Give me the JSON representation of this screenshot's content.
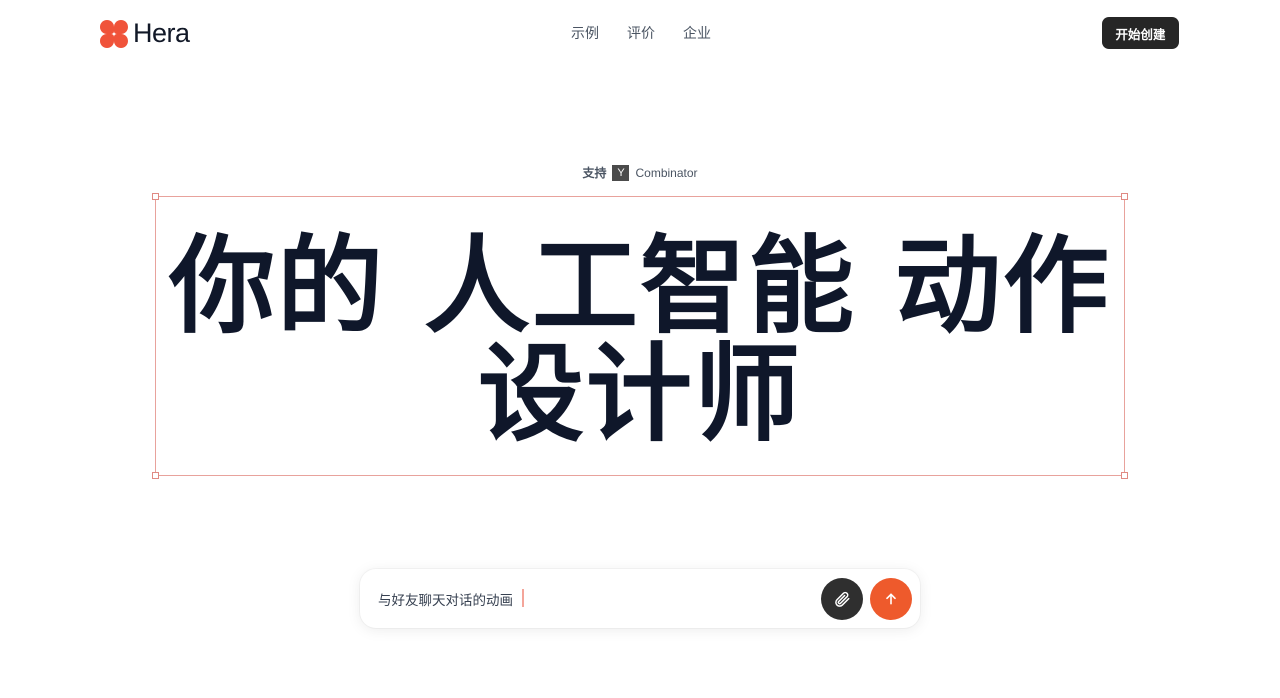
{
  "header": {
    "brand": "Hera",
    "nav": [
      "示例",
      "评价",
      "企业"
    ],
    "cta_label": "开始创建"
  },
  "backed": {
    "label": "支持",
    "badge_letter": "Y",
    "name": "Combinator"
  },
  "hero": {
    "line1": "你的 人工智能 动作",
    "line2": "设计师"
  },
  "prompt": {
    "value": "与好友聊天对话的动画",
    "attach_icon": "paperclip-icon",
    "send_icon": "arrow-up-icon"
  },
  "colors": {
    "brand": "#f0533a",
    "send": "#ee5a2c",
    "dark": "#262626",
    "selection": "#e8a29c"
  }
}
